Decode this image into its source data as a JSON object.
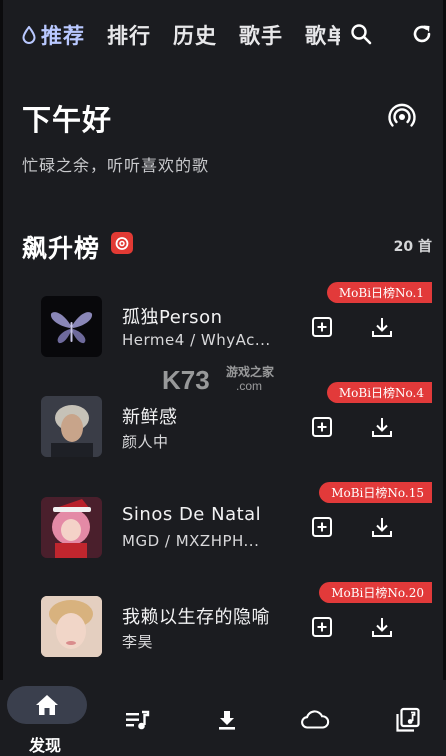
{
  "topbar": {
    "tabs": [
      {
        "label": "推荐",
        "active": true
      },
      {
        "label": "排行"
      },
      {
        "label": "历史"
      },
      {
        "label": "歌手"
      },
      {
        "label": "歌单"
      }
    ],
    "icons": [
      "search-icon",
      "refresh-icon"
    ]
  },
  "greeting": {
    "title": "下午好",
    "subtitle": "忙碌之余，听听喜欢的歌"
  },
  "section": {
    "title": "飙升榜",
    "count": "20 首",
    "icon": "netease-music-icon"
  },
  "songs": [
    {
      "title": "孤独Person",
      "artist": "Herme4 / WhyAc...",
      "badge": "MoBi日榜No.1"
    },
    {
      "title": "新鲜感",
      "artist": "颜人中",
      "badge": "MoBi日榜No.4"
    },
    {
      "title": "Sinos De Natal",
      "artist": "MGD / MXZHPH...",
      "badge": "MoBi日榜No.15"
    },
    {
      "title": "我赖以生存的隐喻",
      "artist": "李昊",
      "badge": "MoBi日榜No.20"
    }
  ],
  "bottom_nav": {
    "items": [
      {
        "label": "发现",
        "icon": "home-icon",
        "active": true
      },
      {
        "icon": "playlist-icon"
      },
      {
        "icon": "download-icon"
      },
      {
        "icon": "cloud-icon"
      },
      {
        "icon": "music-library-icon"
      }
    ]
  },
  "watermark": {
    "text": "K73",
    "sub": "游戏之家",
    "domain": ".com"
  },
  "colors": {
    "background": "#1b1c20",
    "accent": "#b9c8ff",
    "badge": "#e23a3a",
    "nav_pill": "#3a3f4d"
  }
}
